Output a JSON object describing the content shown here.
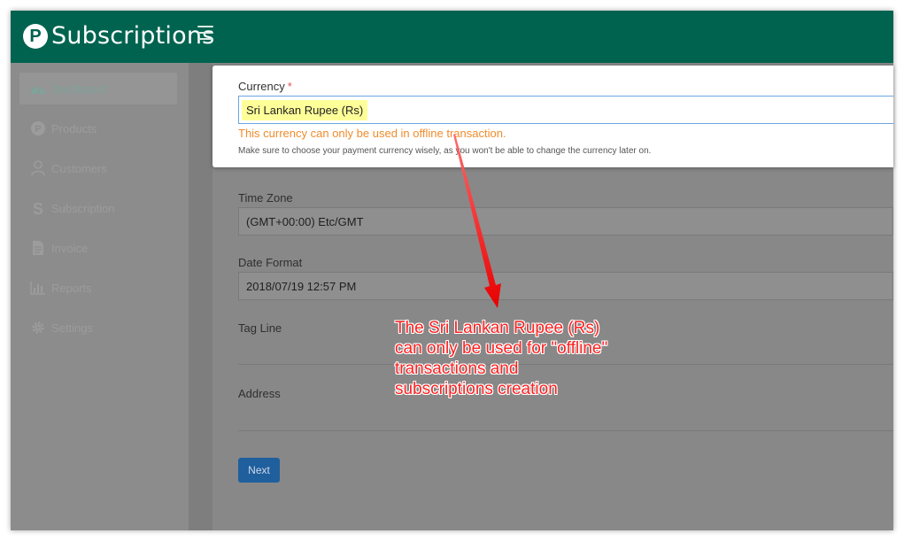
{
  "app": {
    "logo_letter": "P",
    "name": "Subscriptions"
  },
  "sidebar": {
    "items": [
      {
        "label": "Dashboard",
        "icon": "dashboard-icon",
        "active": true
      },
      {
        "label": "Products",
        "icon": "products-p-icon"
      },
      {
        "label": "Customers",
        "icon": "user-icon"
      },
      {
        "label": "Subscription",
        "icon": "subscription-s-icon"
      },
      {
        "label": "Invoice",
        "icon": "document-icon"
      },
      {
        "label": "Reports",
        "icon": "bar-chart-icon"
      },
      {
        "label": "Settings",
        "icon": "gear-icon"
      }
    ]
  },
  "form": {
    "currency": {
      "label": "Currency",
      "required_mark": "*",
      "value": "Sri Lankan Rupee (Rs)",
      "warning": "This currency can only be used in offline transaction.",
      "help": "Make sure to choose your payment currency wisely, as you won't be able to change the currency later on."
    },
    "timezone": {
      "label": "Time Zone",
      "value": "(GMT+00:00) Etc/GMT"
    },
    "date_format": {
      "label": "Date Format",
      "value": "2018/07/19 12:57 PM"
    },
    "tag_line": {
      "label": "Tag Line",
      "value": ""
    },
    "address": {
      "label": "Address",
      "value": ""
    },
    "next_label": "Next"
  },
  "annotation": {
    "lines": [
      "The Sri Lankan Rupee (Rs)",
      "can only be used for \"offline\"",
      "transactions and",
      "subscriptions creation"
    ]
  },
  "colors": {
    "brand_green": "#00634f",
    "warning_orange": "#ef8c2c",
    "annotation_red": "#ff1f1f",
    "highlight_yellow": "#ffff99",
    "button_blue": "#1f5f9e"
  }
}
